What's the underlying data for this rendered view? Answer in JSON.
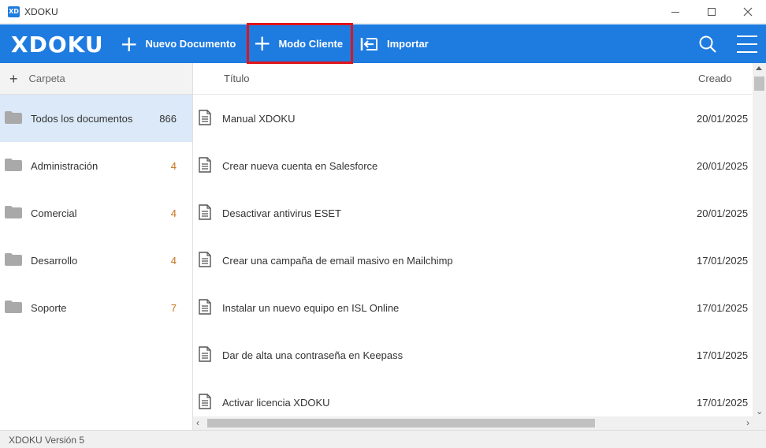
{
  "window": {
    "title": "XDOKU",
    "app_icon_text": "XD"
  },
  "topbar": {
    "logo": "XDOKU",
    "new_document": "Nuevo Documento",
    "client_mode": "Modo Cliente",
    "import": "Importar"
  },
  "sidebar": {
    "header": "Carpeta",
    "folders": [
      {
        "label": "Todos los documentos",
        "count": "866",
        "active": true
      },
      {
        "label": "Administración",
        "count": "4"
      },
      {
        "label": "Comercial",
        "count": "4"
      },
      {
        "label": "Desarrollo",
        "count": "4"
      },
      {
        "label": "Soporte",
        "count": "7"
      }
    ]
  },
  "list": {
    "col_title": "Título",
    "col_created": "Creado",
    "rows": [
      {
        "title": "Manual XDOKU",
        "date": "20/01/2025"
      },
      {
        "title": "Crear nueva cuenta en Salesforce",
        "date": "20/01/2025"
      },
      {
        "title": "Desactivar antivirus ESET",
        "date": "20/01/2025"
      },
      {
        "title": "Crear una campaña de email masivo en Mailchimp",
        "date": "17/01/2025"
      },
      {
        "title": "Instalar un nuevo equipo en ISL Online",
        "date": "17/01/2025"
      },
      {
        "title": "Dar de alta una contraseña en Keepass",
        "date": "17/01/2025"
      },
      {
        "title": "Activar licencia XDOKU",
        "date": "17/01/2025"
      }
    ]
  },
  "status": {
    "version": "XDOKU Versión 5"
  },
  "colors": {
    "accent": "#1e7be0",
    "highlight_border": "#e0141a",
    "active_row": "#dbe9f8"
  }
}
